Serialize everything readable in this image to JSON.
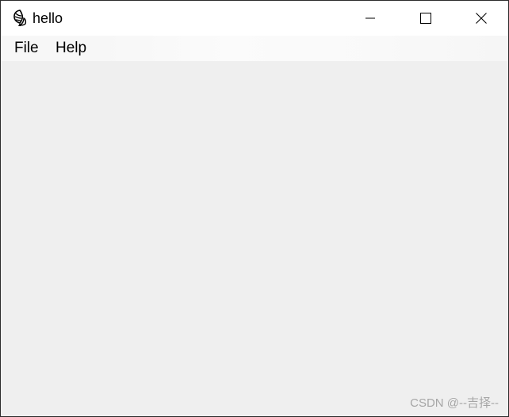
{
  "window": {
    "title": "hello",
    "icon": "python-feather-icon"
  },
  "caption_buttons": {
    "minimize_icon": "minimize-icon",
    "maximize_icon": "maximize-icon",
    "close_icon": "close-icon"
  },
  "menubar": {
    "items": [
      {
        "label": "File"
      },
      {
        "label": "Help"
      }
    ]
  },
  "watermark": {
    "text": "CSDN @--吉择--"
  },
  "colors": {
    "titlebar": "#ffffff",
    "client": "#efefef",
    "border": "#2b2b2b",
    "watermark": "#a6a6a6"
  }
}
